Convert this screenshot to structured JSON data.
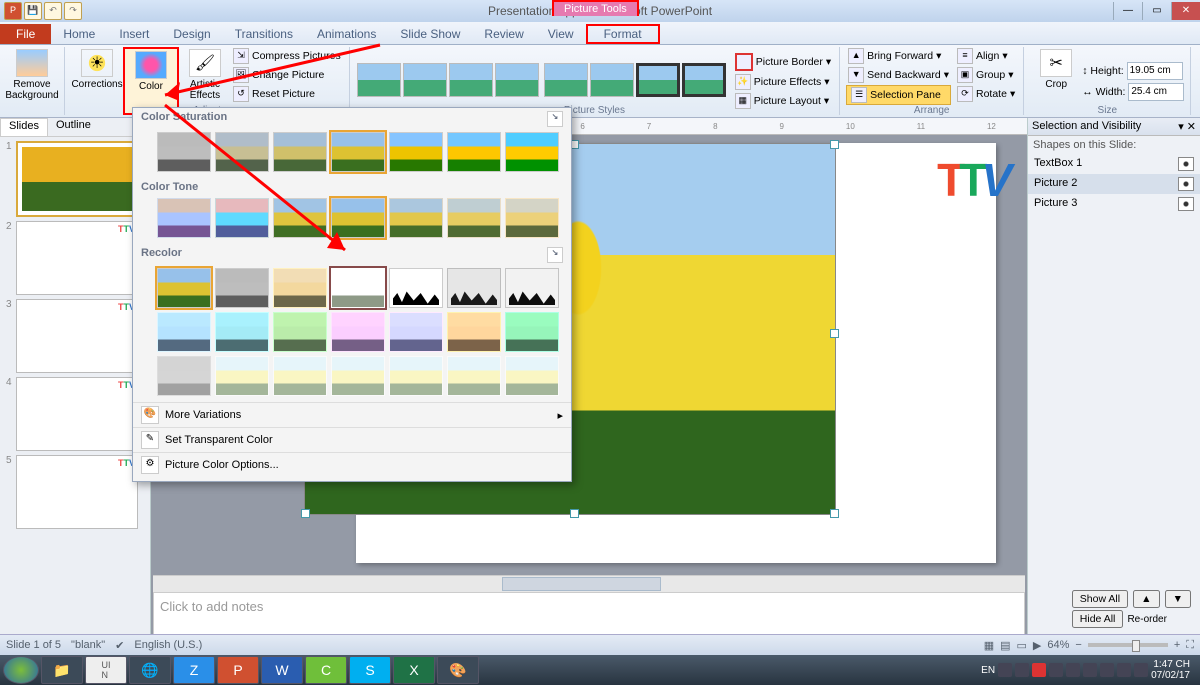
{
  "title": "Presentation1.pptx - Microsoft PowerPoint",
  "contextual_tab": "Picture Tools",
  "tabs": [
    "File",
    "Home",
    "Insert",
    "Design",
    "Transitions",
    "Animations",
    "Slide Show",
    "Review",
    "View",
    "Format"
  ],
  "ribbon": {
    "remove_bg": "Remove Background",
    "corrections": "Corrections",
    "color": "Color",
    "artistic": "Artistic Effects",
    "compress": "Compress Pictures",
    "change": "Change Picture",
    "reset": "Reset Picture",
    "adjust_label": "Adjust",
    "styles_label": "Picture Styles",
    "border": "Picture Border",
    "effects": "Picture Effects",
    "layout": "Picture Layout",
    "bring": "Bring Forward",
    "send": "Send Backward",
    "selpane": "Selection Pane",
    "align": "Align",
    "group": "Group",
    "rotate": "Rotate",
    "arrange_label": "Arrange",
    "crop": "Crop",
    "height_l": "Height:",
    "width_l": "Width:",
    "height_v": "19.05 cm",
    "width_v": "25.4 cm",
    "size_label": "Size"
  },
  "slide_tabs": {
    "slides": "Slides",
    "outline": "Outline"
  },
  "dropdown": {
    "sat": "Color Saturation",
    "tone": "Color Tone",
    "recolor": "Recolor",
    "more": "More Variations",
    "transparent": "Set Transparent Color",
    "options": "Picture Color Options..."
  },
  "notes_placeholder": "Click to add notes",
  "selection_pane": {
    "title": "Selection and Visibility",
    "sub": "Shapes on this Slide:",
    "items": [
      "TextBox 1",
      "Picture 2",
      "Picture 3"
    ],
    "showall": "Show All",
    "hideall": "Hide All",
    "reorder": "Re-order"
  },
  "status": {
    "slide": "Slide 1 of 5",
    "theme": "\"blank\"",
    "lang": "English (U.S.)",
    "zoom": "64%"
  },
  "taskbar": {
    "lang": "EN",
    "time": "1:47 CH",
    "date": "07/02/17"
  }
}
